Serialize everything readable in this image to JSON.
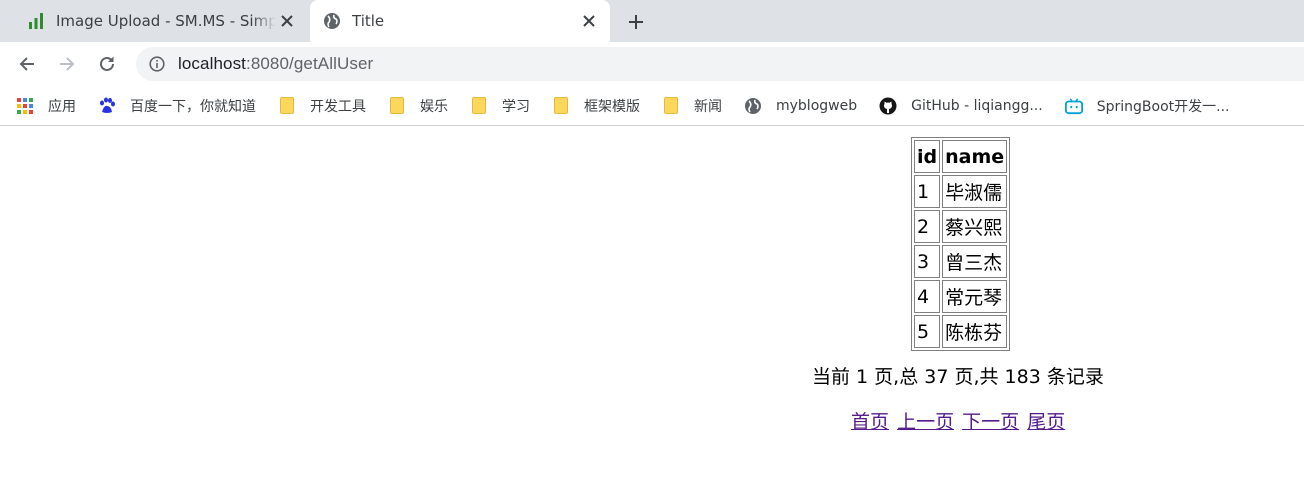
{
  "tabs": [
    {
      "title": "Image Upload - SM.MS - Simple Free Image Hosting",
      "active": false,
      "icon": "bar-chart-icon"
    },
    {
      "title": "Title",
      "active": true,
      "icon": "globe-icon"
    }
  ],
  "toolbar": {
    "url_host": "localhost",
    "url_rest": ":8080/getAllUser"
  },
  "bookmarks": [
    {
      "label": "应用",
      "icon": "apps-grid-icon"
    },
    {
      "label": "百度一下，你就知道",
      "icon": "baidu-paw-icon"
    },
    {
      "label": "开发工具",
      "icon": "folder-icon"
    },
    {
      "label": "娱乐",
      "icon": "folder-icon"
    },
    {
      "label": "学习",
      "icon": "folder-icon"
    },
    {
      "label": "框架模版",
      "icon": "folder-icon"
    },
    {
      "label": "新闻",
      "icon": "folder-icon"
    },
    {
      "label": "myblogweb",
      "icon": "globe-icon"
    },
    {
      "label": "GitHub - liqiangg...",
      "icon": "github-icon"
    },
    {
      "label": "SpringBoot开发一...",
      "icon": "bilibili-icon"
    }
  ],
  "users_table": {
    "headers": [
      "id",
      "name"
    ],
    "rows": [
      [
        "1",
        "毕淑儒"
      ],
      [
        "2",
        "蔡兴熙"
      ],
      [
        "3",
        "曾三杰"
      ],
      [
        "4",
        "常元琴"
      ],
      [
        "5",
        "陈栋芬"
      ]
    ]
  },
  "pagination": {
    "summary": "当前 1 页,总 37 页,共 183 条记录",
    "links": [
      "首页",
      "上一页",
      "下一页",
      "尾页"
    ]
  },
  "colors": {
    "tabstrip": "#dee1e6",
    "omnibox": "#f1f3f4",
    "visited_link": "#551a8b"
  }
}
